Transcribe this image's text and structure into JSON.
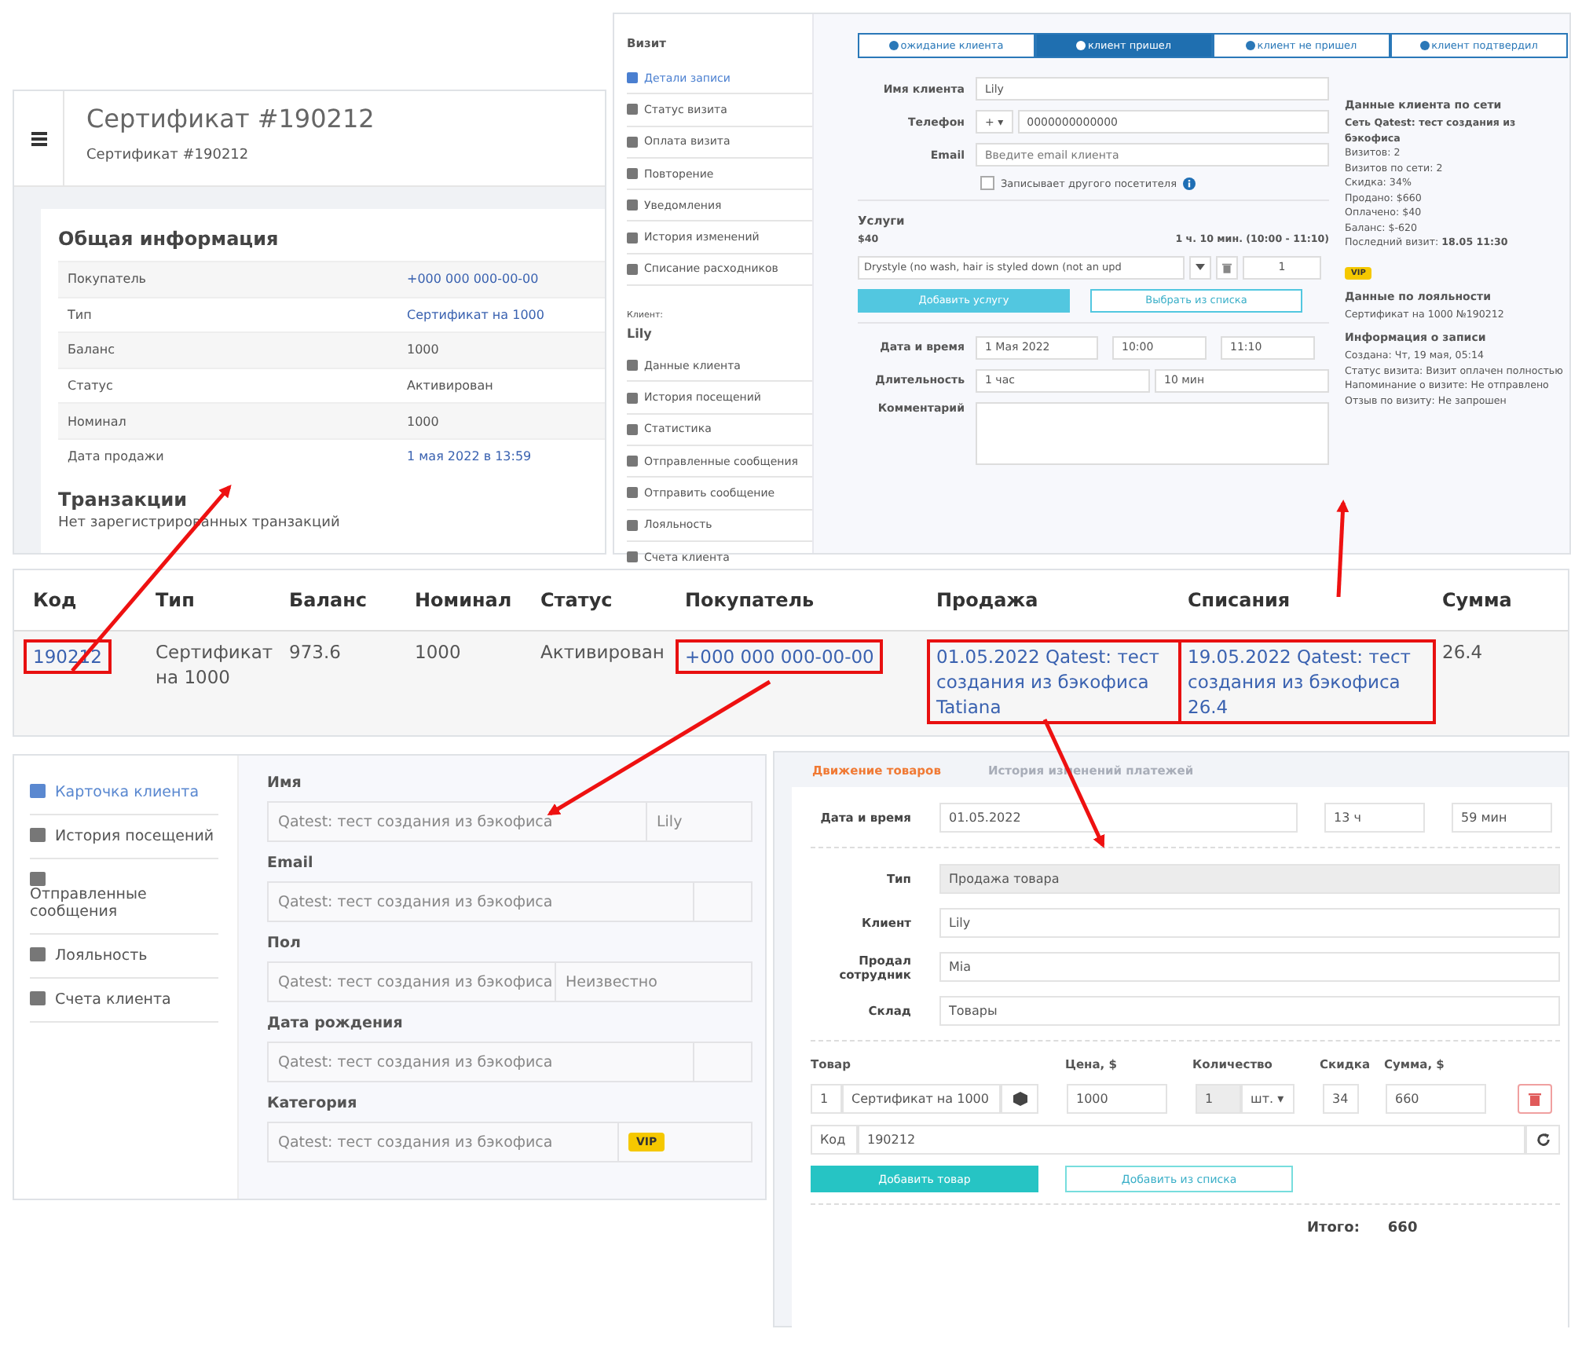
{
  "certificate_page": {
    "title": "Сертификат #190212",
    "subtitle": "Сертификат #190212",
    "section_title": "Общая информация",
    "info_rows": [
      {
        "label": "Покупатель",
        "value": "+000 000 000-00-00",
        "link": true
      },
      {
        "label": "Тип",
        "value": "Сертификат на 1000",
        "link": true
      },
      {
        "label": "Баланс",
        "value": "1000",
        "link": false
      },
      {
        "label": "Статус",
        "value": "Активирован",
        "link": false
      },
      {
        "label": "Номинал",
        "value": "1000",
        "link": false
      },
      {
        "label": "Дата продажи",
        "value": "1 мая 2022 в 13:59",
        "link": true
      }
    ],
    "transactions_title": "Транзакции",
    "transactions_empty": "Нет зарегистрированных транзакций"
  },
  "visit_page": {
    "sidebar_title": "Визит",
    "visit_items": [
      {
        "label": "Детали записи",
        "selected": true
      },
      {
        "label": "Статус визита",
        "selected": false
      },
      {
        "label": "Оплата визита",
        "selected": false
      },
      {
        "label": "Повторение",
        "selected": false
      },
      {
        "label": "Уведомления",
        "selected": false
      },
      {
        "label": "История изменений",
        "selected": false
      },
      {
        "label": "Списание расходников",
        "selected": false
      }
    ],
    "client_caption": "Клиент:",
    "client_name": "Lily",
    "client_items": [
      "Данные клиента",
      "История посещений",
      "Статистика",
      "Отправленные сообщения",
      "Отправить сообщение",
      "Лояльность",
      "Счета клиента"
    ],
    "status_tabs": [
      {
        "label": "ожидание клиента",
        "selected": false
      },
      {
        "label": "клиент пришел",
        "selected": true
      },
      {
        "label": "клиент не пришел",
        "selected": false
      },
      {
        "label": "клиент подтвердил",
        "selected": false
      }
    ],
    "name_label": "Имя клиента",
    "name_value": "Lily",
    "phone_label": "Телефон",
    "phone_prefix": "+ ▾",
    "phone_value": "0000000000000",
    "email_label": "Email",
    "email_placeholder": "Введите email клиента",
    "other_visitor_label": "Записывает другого посетителя",
    "other_visitor_checked": false,
    "services_title": "Услуги",
    "services_price": "$40",
    "services_duration": "1 ч. 10 мин. (10:00 - 11:10)",
    "service_value": "Drystyle (no wash, hair is styled down (not an upd",
    "service_qty": "1",
    "add_service_button": "Добавить услугу",
    "pick_list_button": "Выбрать из списка",
    "date_label": "Дата и время",
    "date_value": "1 Мая 2022",
    "time_from": "10:00",
    "time_to": "11:10",
    "duration_label": "Длительность",
    "duration_hours": "1 час",
    "duration_minutes": "10 мин",
    "comment_label": "Комментарий",
    "network_title": "Данные клиента по сети",
    "network_name": "Сеть Qatest: тест создания из бэкофиса",
    "network_stats": [
      "Визитов: 2",
      "Визитов по сети: 2",
      "Скидка: 34%",
      "Продано: $660",
      "Оплачено: $40",
      "Баланс: $-620"
    ],
    "last_visit_label": "Последний визит:",
    "last_visit": "18.05 11:30",
    "vip_badge": "VIP",
    "loyalty_title": "Данные по лояльности",
    "loyalty_text": "Сертификат на 1000 №190212",
    "record_title": "Информация о записи",
    "record_lines": [
      "Создана: Чт, 19 мая, 05:14",
      "Статус визита: Визит оплачен полностью",
      "Напоминание о визите: Не отправлено",
      "Отзыв по визиту: Не запрошен"
    ]
  },
  "certificates_table": {
    "columns": [
      "Код",
      "Тип",
      "Баланс",
      "Номинал",
      "Статус",
      "Покупатель",
      "Продажа",
      "Списания",
      "Сумма"
    ],
    "rows": [
      {
        "cells": [
          {
            "text": "190212",
            "link": true,
            "highlighted": true
          },
          {
            "text": "Сертификат на 1000",
            "link": false,
            "highlighted": false
          },
          {
            "text": "973.6",
            "link": false,
            "highlighted": false
          },
          {
            "text": "1000",
            "link": false,
            "highlighted": false
          },
          {
            "text": "Активирован",
            "link": false,
            "highlighted": false
          },
          {
            "text": "+000 000 000-00-00",
            "link": true,
            "highlighted": true
          },
          {
            "text": "01.05.2022 Qatest: тест создания из бэкофиса Tatiana",
            "link": true,
            "highlighted": true
          },
          {
            "text": "19.05.2022 Qatest: тест создания из бэкофиса 26.4",
            "link": true,
            "highlighted": true
          },
          {
            "text": "26.4",
            "link": false,
            "highlighted": false
          }
        ]
      }
    ]
  },
  "client_card": {
    "menu": [
      {
        "label": "Карточка клиента",
        "selected": true
      },
      {
        "label": "История посещений",
        "selected": false
      },
      {
        "label": "Отправленные сообщения",
        "selected": false
      },
      {
        "label": "Лояльность",
        "selected": false
      },
      {
        "label": "Счета клиента",
        "selected": false
      }
    ],
    "fields": [
      {
        "label": "Имя",
        "value": "Qatest: тест создания из бэкофиса",
        "extra": "Lily",
        "kind": "text"
      },
      {
        "label": "Email",
        "value": "Qatest: тест создания из бэкофиса",
        "kind": "empty"
      },
      {
        "label": "Пол",
        "value": "Qatest: тест создания из бэкофиса",
        "extra": "Неизвестно",
        "kind": "wide"
      },
      {
        "label": "Дата рождения",
        "value": "Qatest: тест создания из бэкофиса",
        "kind": "empty"
      },
      {
        "label": "Категория",
        "value": "Qatest: тест создания из бэкофиса",
        "extra": "VIP",
        "kind": "badge"
      }
    ]
  },
  "goods_movement": {
    "tabs": [
      {
        "label": "Движение товаров",
        "selected": true
      },
      {
        "label": "История изменений платежей",
        "selected": false
      }
    ],
    "date_label": "Дата и время",
    "date_value": "01.05.2022",
    "hour": "13 ч",
    "minute": "59 мин",
    "type_label": "Тип",
    "type_value": "Продажа товара",
    "client_label": "Клиент",
    "client_value": "Lily",
    "seller_label": "Продал сотрудник",
    "seller_value": "Mia",
    "store_label": "Склад",
    "store_value": "Товары",
    "item_headers": [
      "Товар",
      "Цена, $",
      "Количество",
      "Скидка",
      "Сумма, $"
    ],
    "item": {
      "index": "1",
      "name": "Сертификат на 1000",
      "price": "1000",
      "qty": "1",
      "unit": "шт. ▾",
      "discount": "34",
      "sum": "660"
    },
    "code_label": "Код",
    "code_value": "190212",
    "add_button": "Добавить товар",
    "add_list_button": "Добавить из списка",
    "total_label": "Итого:",
    "total": "660"
  }
}
